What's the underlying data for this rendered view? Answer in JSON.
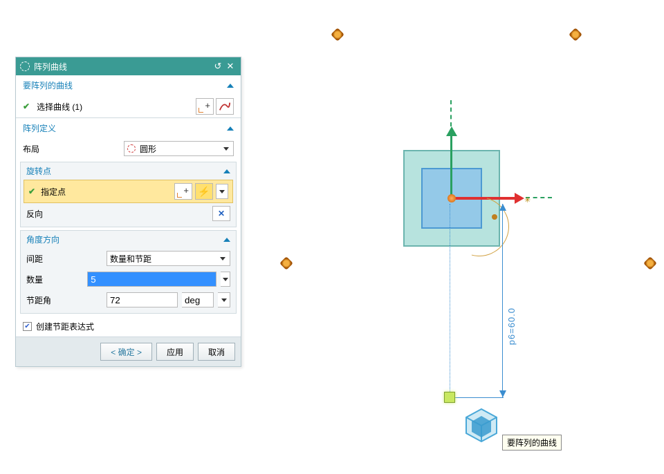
{
  "dialog": {
    "title": "阵列曲线",
    "sections": {
      "curveToPattern": {
        "header": "要阵列的曲线",
        "selectLabel": "选择曲线 (1)"
      },
      "patternDef": {
        "header": "阵列定义",
        "layoutLabel": "布局",
        "layoutValue": "圆形"
      },
      "rotPoint": {
        "header": "旋转点",
        "specifyLabel": "指定点",
        "reverseLabel": "反向"
      },
      "angleDir": {
        "header": "角度方向",
        "spacingLabel": "间距",
        "spacingValue": "数量和节距",
        "countLabel": "数量",
        "countValue": "5",
        "pitchLabel": "节距角",
        "pitchValue": "72",
        "pitchUnit": "deg"
      },
      "createExprLabel": "创建节距表达式"
    },
    "buttons": {
      "ok": "< 确定 >",
      "apply": "应用",
      "cancel": "取消"
    }
  },
  "canvas": {
    "dimLabel": "p6=60.0",
    "tooltip": "要阵列的曲线"
  }
}
